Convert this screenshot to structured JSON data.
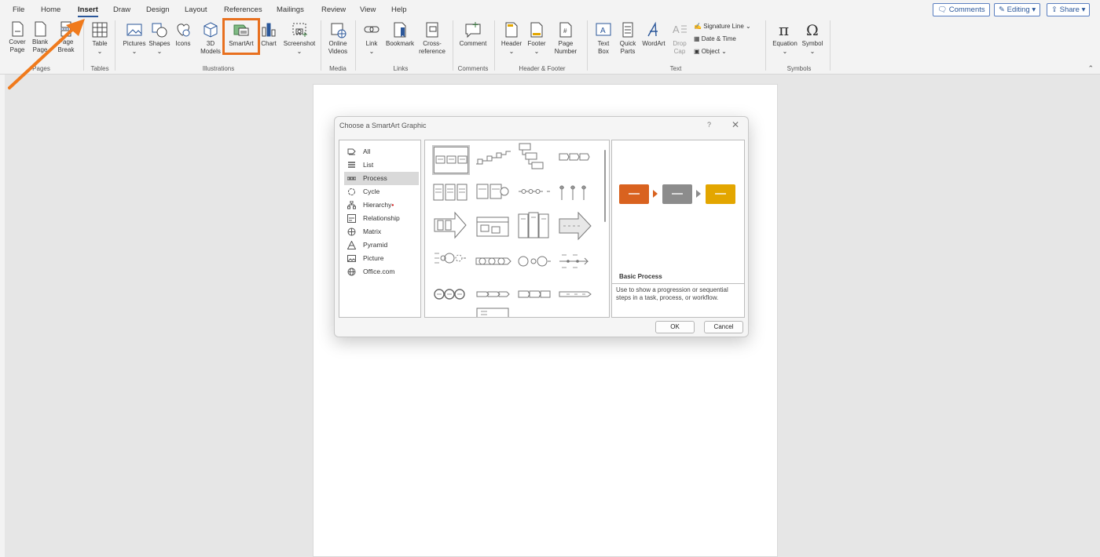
{
  "menu": {
    "tabs": [
      "File",
      "Home",
      "Insert",
      "Draw",
      "Design",
      "Layout",
      "References",
      "Mailings",
      "Review",
      "View",
      "Help"
    ],
    "active_tab": "Insert",
    "comments": "Comments",
    "editing": "Editing",
    "share": "Share"
  },
  "ribbon": {
    "cover_page": "Cover",
    "cover_page2": "Page",
    "blank_page": "Blank",
    "blank_page2": "Page",
    "page_break": "Page",
    "page_break2": "Break",
    "table": "Table",
    "pictures": "Pictures",
    "shapes": "Shapes",
    "icons": "Icons",
    "models_3d": "3D",
    "models_3d2": "Models",
    "smartart": "SmartArt",
    "chart": "Chart",
    "screenshot": "Screenshot",
    "online_videos": "Online",
    "online_videos2": "Videos",
    "link": "Link",
    "bookmark": "Bookmark",
    "cross_ref": "Cross-",
    "cross_ref2": "reference",
    "comment": "Comment",
    "header": "Header",
    "footer": "Footer",
    "page_number": "Page",
    "page_number2": "Number",
    "text_box": "Text",
    "text_box2": "Box",
    "quick_parts": "Quick",
    "quick_parts2": "Parts",
    "wordart": "WordArt",
    "drop_cap": "Drop",
    "drop_cap2": "Cap",
    "signature_line": "Signature Line",
    "date_time": "Date & Time",
    "object": "Object",
    "equation": "Equation",
    "symbol": "Symbol",
    "groups": {
      "pages": "Pages",
      "tables": "Tables",
      "illustrations": "Illustrations",
      "media": "Media",
      "links": "Links",
      "comments": "Comments",
      "header_footer": "Header & Footer",
      "text": "Text",
      "symbols": "Symbols"
    }
  },
  "dialog": {
    "title": "Choose a SmartArt Graphic",
    "help": "?",
    "close": "✕",
    "categories": [
      {
        "label": "All",
        "icon": "all-icon"
      },
      {
        "label": "List",
        "icon": "list-icon"
      },
      {
        "label": "Process",
        "icon": "process-icon"
      },
      {
        "label": "Cycle",
        "icon": "cycle-icon"
      },
      {
        "label": "Hierarchy",
        "icon": "hierarchy-icon"
      },
      {
        "label": "Relationship",
        "icon": "relationship-icon"
      },
      {
        "label": "Matrix",
        "icon": "matrix-icon"
      },
      {
        "label": "Pyramid",
        "icon": "pyramid-icon"
      },
      {
        "label": "Picture",
        "icon": "picture-icon"
      },
      {
        "label": "Office.com",
        "icon": "globe-icon"
      }
    ],
    "selected_category": "Process",
    "preview_title": "Basic Process",
    "preview_desc": "Use to show a progression or sequential steps in a task, process, or workflow.",
    "ok": "OK",
    "cancel": "Cancel",
    "preview_colors": [
      "#d9621f",
      "#8c8c8c",
      "#e3a600"
    ]
  }
}
